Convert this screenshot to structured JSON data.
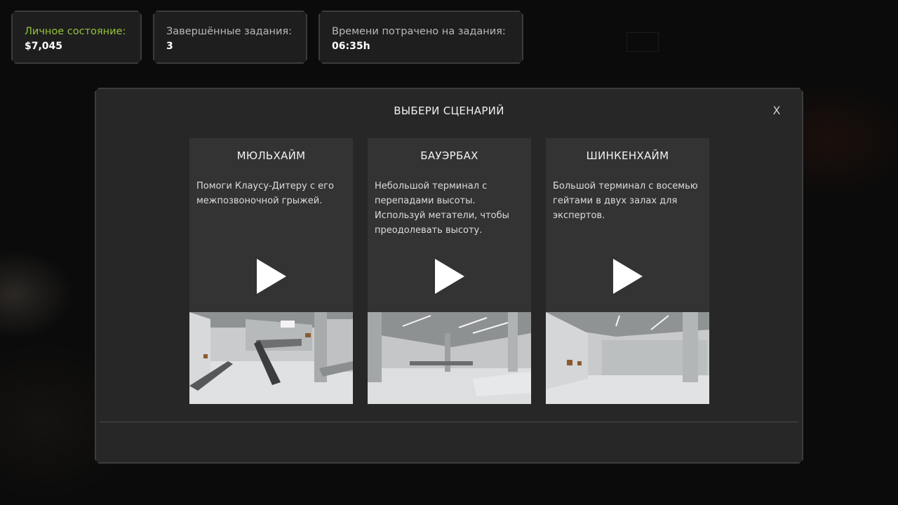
{
  "stats": [
    {
      "label": "Личное состояние:",
      "value": "$7,045"
    },
    {
      "label": "Завершённые задания:",
      "value": "3"
    },
    {
      "label": "Времени потрачено на задания:",
      "value": "06:35h"
    }
  ],
  "colors": {
    "accent_green": "#93c23b",
    "panel": "#272727",
    "card": "#333333"
  },
  "modal": {
    "title": "ВЫБЕРИ СЦЕНАРИЙ",
    "close_label": "X",
    "scenarios": [
      {
        "title": "МЮЛЬХАЙМ",
        "description": "Помоги Клаусу-Дитеру с его межпозвоночной грыжей.",
        "icon": "play-icon"
      },
      {
        "title": "БАУЭРБАХ",
        "description": "Небольшой терминал с перепадами высоты. Используй метатели, чтобы преодолевать высоту.",
        "icon": "play-icon"
      },
      {
        "title": "ШИНКЕНХАЙМ",
        "description": "Большой терминал с восемью гейтами в двух залах для экспертов.",
        "icon": "play-icon"
      }
    ]
  }
}
